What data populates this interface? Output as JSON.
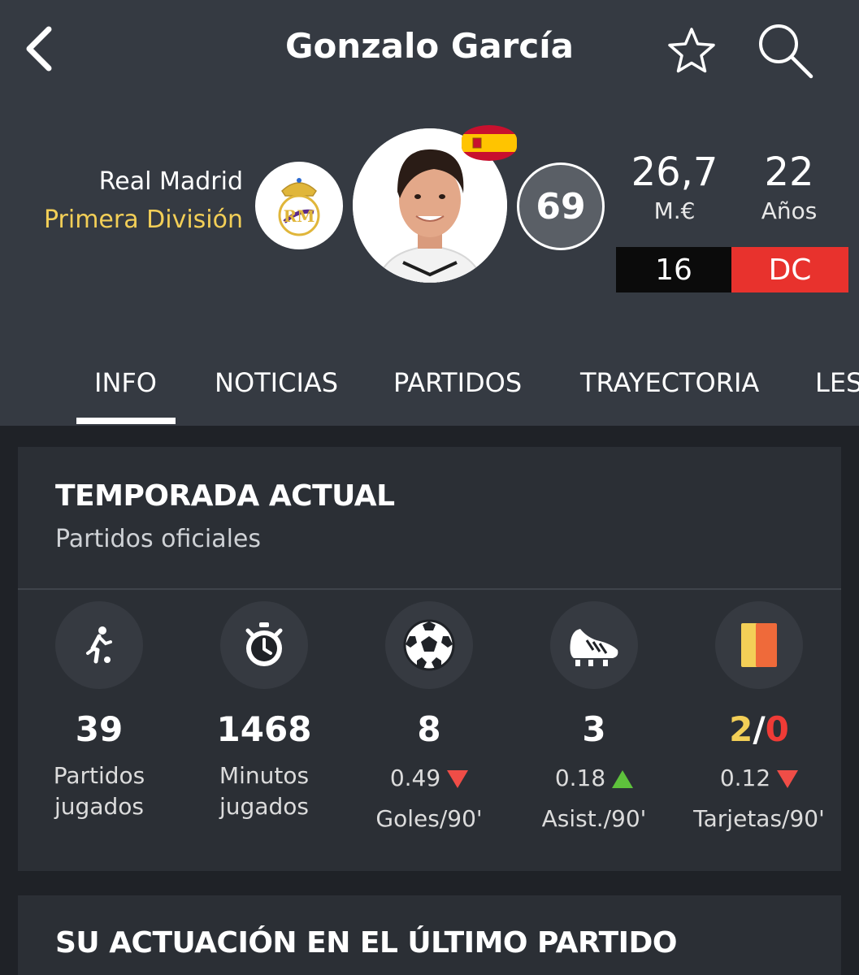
{
  "header": {
    "title": "Gonzalo García",
    "back_icon": "chevron-left-icon",
    "favorite_icon": "star-icon",
    "search_icon": "search-icon"
  },
  "player": {
    "team": "Real Madrid",
    "league": "Primera División",
    "rating": "69",
    "nationality_flag": "spain-flag",
    "market_value": "26,7",
    "market_value_label": "M.€",
    "age": "22",
    "age_label": "Años",
    "shirt_number": "16",
    "position": "DC"
  },
  "colors": {
    "header_bg": "#353a42",
    "league_yellow": "#f3cf57",
    "position_red": "#e8322d",
    "trend_down": "#ef4d47",
    "trend_up": "#5ec13c"
  },
  "tabs": [
    {
      "label": "INFO",
      "active": true
    },
    {
      "label": "NOTICIAS"
    },
    {
      "label": "PARTIDOS"
    },
    {
      "label": "TRAYECTORIA"
    },
    {
      "label": "LES"
    }
  ],
  "season": {
    "title": "TEMPORADA ACTUAL",
    "subtitle": "Partidos oficiales",
    "stats": [
      {
        "icon": "player-running-icon",
        "value": "39",
        "label_line1": "Partidos",
        "label_line2": "jugados"
      },
      {
        "icon": "stopwatch-icon",
        "value": "1468",
        "label": "Minutos jugados"
      },
      {
        "icon": "soccer-ball-icon",
        "value": "8",
        "rate": "0.49",
        "trend": "down",
        "label": "Goles/90'"
      },
      {
        "icon": "football-boot-icon",
        "value": "3",
        "rate": "0.18",
        "trend": "up",
        "label": "Asist./90'"
      },
      {
        "icon": "cards-icon",
        "yellow": "2",
        "separator": "/",
        "red": "0",
        "rate": "0.12",
        "trend": "down",
        "label": "Tarjetas/90'"
      }
    ]
  },
  "last_match": {
    "title": "SU ACTUACIÓN EN EL ÚLTIMO PARTIDO"
  }
}
